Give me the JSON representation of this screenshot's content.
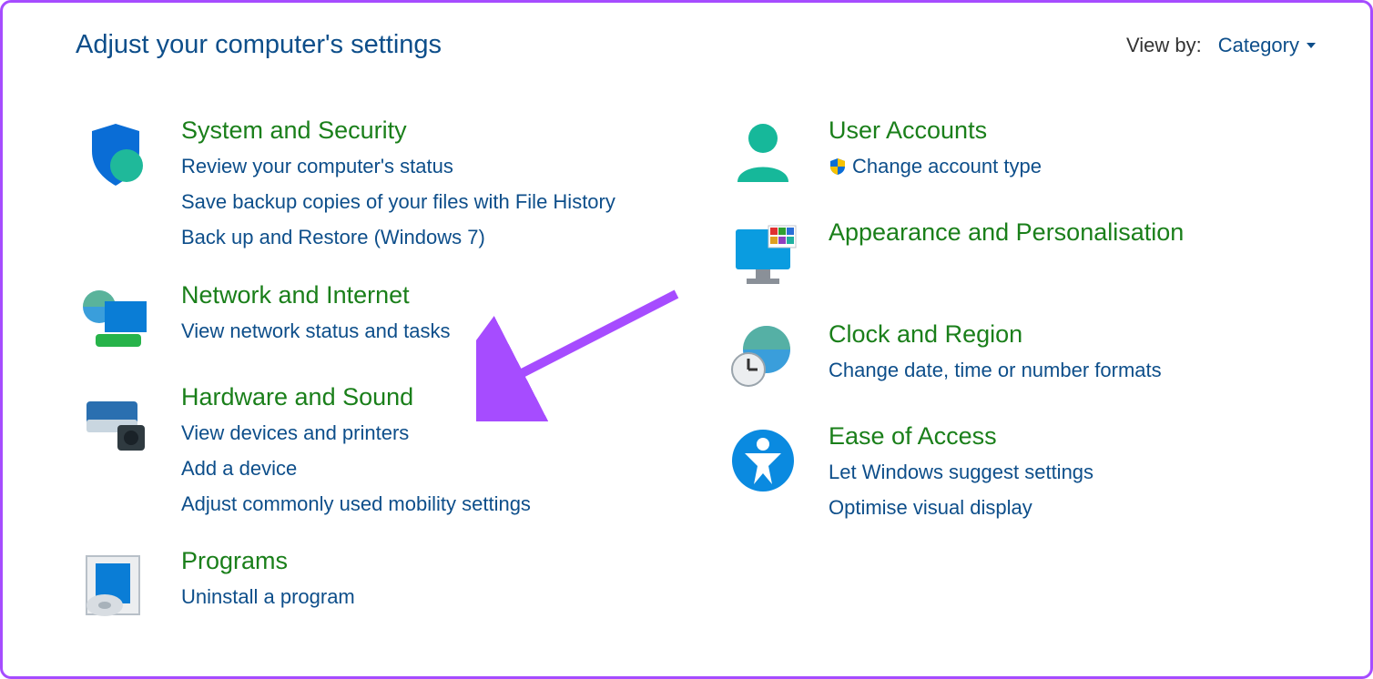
{
  "header": {
    "title": "Adjust your computer's settings",
    "view_by_label": "View by:",
    "view_by_value": "Category"
  },
  "left": [
    {
      "icon": "shield",
      "title": "System and Security",
      "links": [
        {
          "label": "Review your computer's status",
          "shield": false
        },
        {
          "label": "Save backup copies of your files with File History",
          "shield": false
        },
        {
          "label": "Back up and Restore (Windows 7)",
          "shield": false
        }
      ]
    },
    {
      "icon": "network",
      "title": "Network and Internet",
      "links": [
        {
          "label": "View network status and tasks",
          "shield": false
        }
      ]
    },
    {
      "icon": "hardware",
      "title": "Hardware and Sound",
      "links": [
        {
          "label": "View devices and printers",
          "shield": false
        },
        {
          "label": "Add a device",
          "shield": false
        },
        {
          "label": "Adjust commonly used mobility settings",
          "shield": false
        }
      ]
    },
    {
      "icon": "programs",
      "title": "Programs",
      "links": [
        {
          "label": "Uninstall a program",
          "shield": false
        }
      ]
    }
  ],
  "right": [
    {
      "icon": "user",
      "title": "User Accounts",
      "links": [
        {
          "label": "Change account type",
          "shield": true
        }
      ]
    },
    {
      "icon": "appearance",
      "title": "Appearance and Personalisation",
      "links": []
    },
    {
      "icon": "clock",
      "title": "Clock and Region",
      "links": [
        {
          "label": "Change date, time or number formats",
          "shield": false
        }
      ]
    },
    {
      "icon": "ease",
      "title": "Ease of Access",
      "links": [
        {
          "label": "Let Windows suggest settings",
          "shield": false
        },
        {
          "label": "Optimise visual display",
          "shield": false
        }
      ]
    }
  ],
  "annotation": {
    "arrow_color": "#a64cff",
    "target": "Hardware and Sound"
  }
}
